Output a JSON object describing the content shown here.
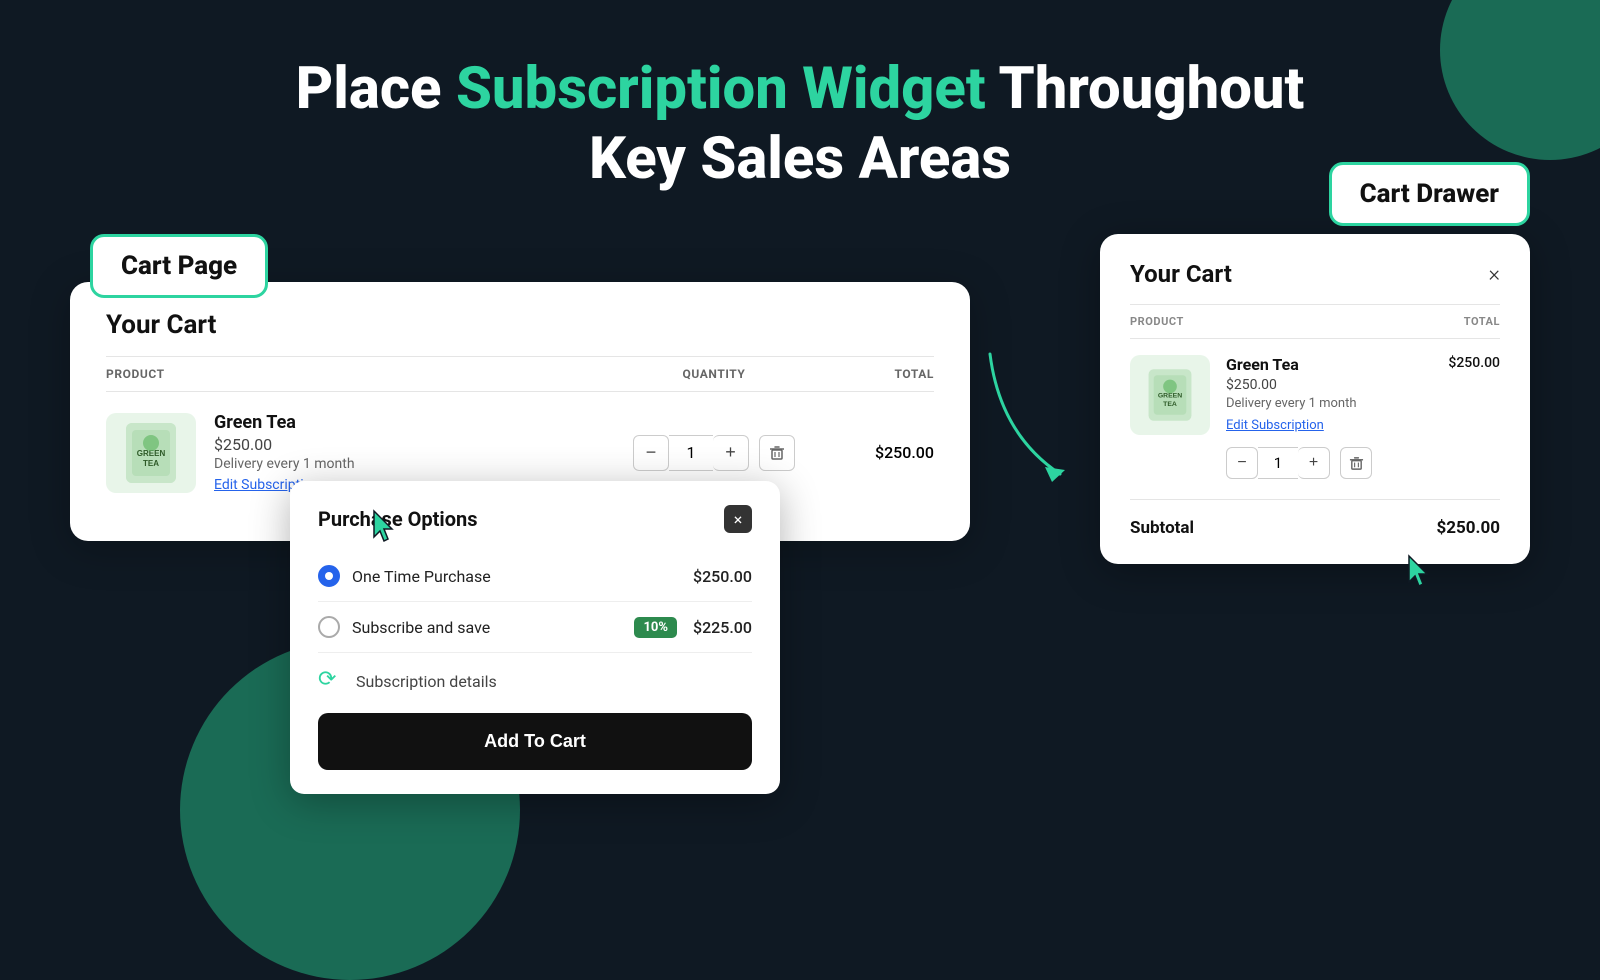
{
  "header": {
    "title_part1": "Place ",
    "title_accent": "Subscription Widget",
    "title_part2": " Throughout",
    "title_line2": "Key Sales Areas"
  },
  "cart_page_label": "Cart Page",
  "cart_drawer_label": "Cart Drawer",
  "cart_modal": {
    "title": "Your Cart",
    "columns": {
      "product": "PRODUCT",
      "quantity": "QUANTITY",
      "total": "TOTAL"
    },
    "item": {
      "name": "Green Tea",
      "price": "$250.00",
      "delivery": "Delivery every 1 month",
      "edit_link": "Edit Subscription",
      "quantity": "1",
      "total": "$250.00"
    }
  },
  "purchase_options": {
    "title": "Purchase Options",
    "close_label": "×",
    "options": [
      {
        "label": "One Time Purchase",
        "price": "$250.00",
        "selected": true,
        "badge": null
      },
      {
        "label": "Subscribe and save",
        "price": "$225.00",
        "selected": false,
        "badge": "10%"
      }
    ],
    "subscription_details_label": "Subscription details",
    "add_to_cart_label": "Add To Cart"
  },
  "cart_drawer": {
    "title": "Your Cart",
    "close_label": "×",
    "columns": {
      "product": "PRODUCT",
      "total": "TOTAL"
    },
    "item": {
      "name": "Green Tea",
      "price": "$250.00",
      "delivery": "Delivery every 1 month",
      "edit_link": "Edit Subscription",
      "quantity": "1",
      "total": "$250.00"
    },
    "subtotal_label": "Subtotal",
    "subtotal_value": "$250.00"
  },
  "colors": {
    "bg": "#0f1923",
    "accent_green": "#2dd4a0",
    "dark_green": "#1a6b55",
    "white": "#ffffff",
    "black": "#111111",
    "blue_link": "#2563eb",
    "save_badge_bg": "#2d8a4e"
  }
}
